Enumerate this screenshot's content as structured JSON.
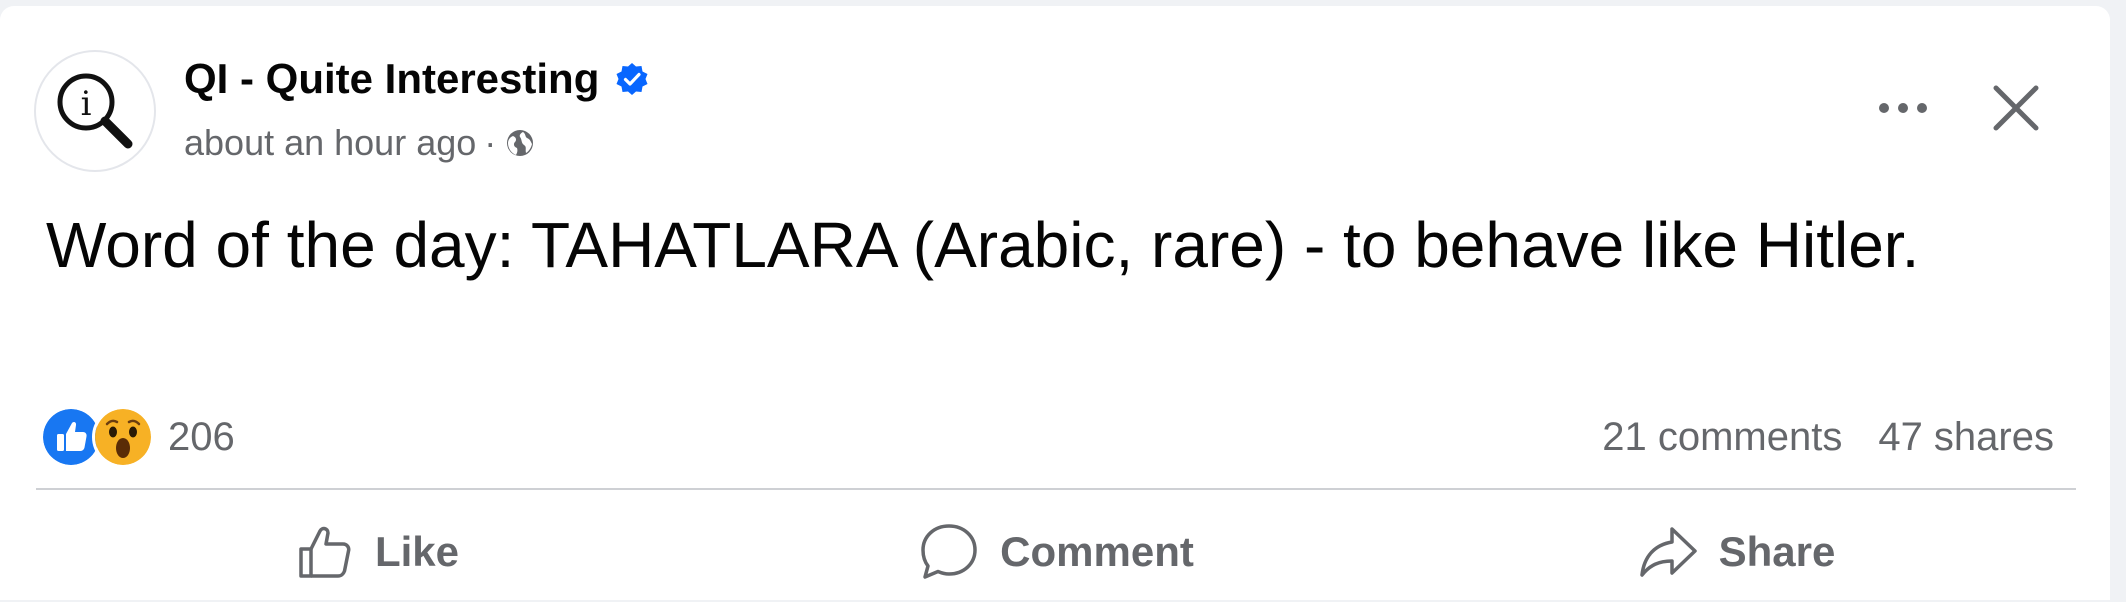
{
  "post": {
    "page_name": "QI - Quite Interesting",
    "timestamp": "about an hour ago",
    "separator": "·",
    "verified_icon": "verified-badge-icon",
    "privacy_icon": "globe-icon",
    "body": "Word of the day: TAHATLARA (Arabic, rare) - to behave like Hitler."
  },
  "reactions": {
    "types": [
      "like",
      "wow"
    ],
    "count": "206",
    "comments": "21 comments",
    "shares": "47 shares"
  },
  "actions": {
    "like_label": "Like",
    "comment_label": "Comment",
    "share_label": "Share"
  },
  "colors": {
    "verified_blue": "#0866ff",
    "secondary_text": "#65676b",
    "like_blue": "#1877f2",
    "wow_yellow": "#f7b125"
  }
}
